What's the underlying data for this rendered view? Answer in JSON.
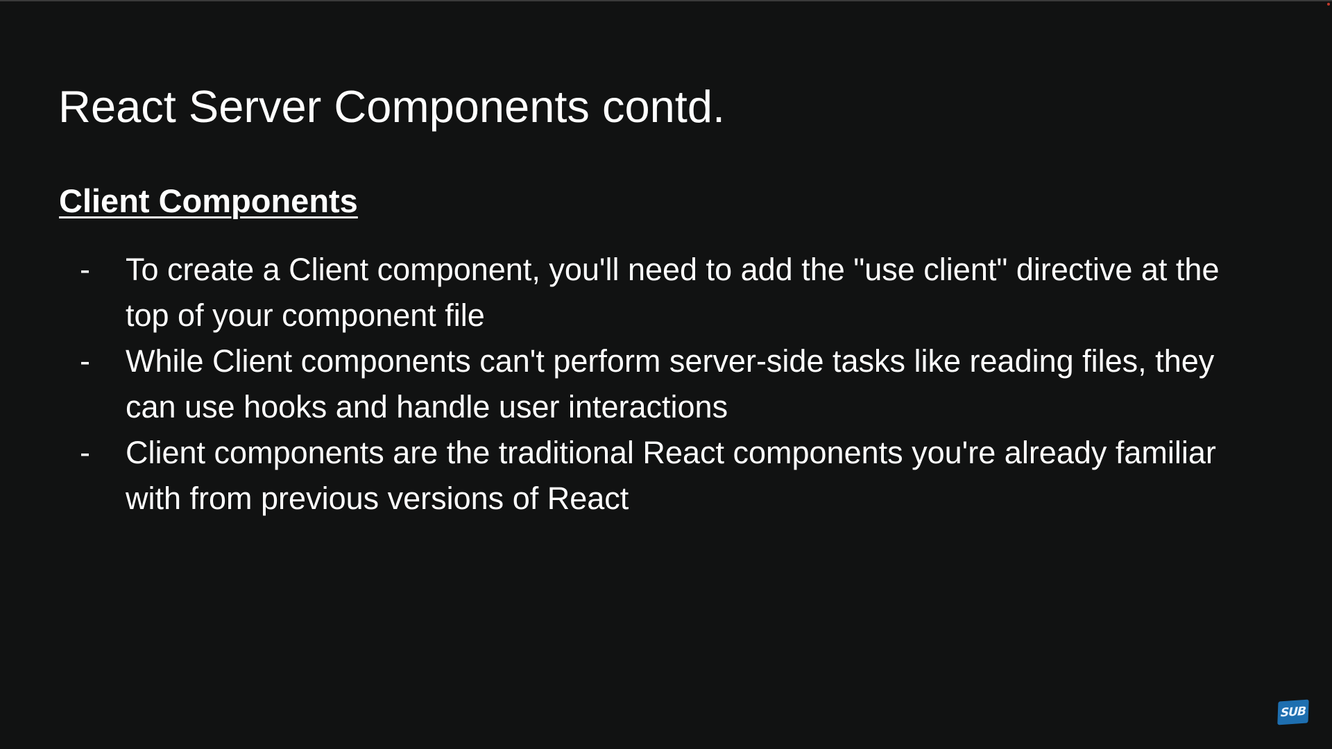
{
  "slide": {
    "title": "React Server Components contd.",
    "section_heading": "Client Components",
    "bullets": [
      {
        "marker": "-",
        "text": "To create a Client component, you'll need to add the \"use client\" directive at the top of your component file"
      },
      {
        "marker": "-",
        "text": "While Client components can't perform server-side tasks like reading files, they can use hooks and handle user interactions"
      },
      {
        "marker": "-",
        "text": "Client components are the traditional React components you're already familiar with from previous versions of React"
      }
    ]
  },
  "watermark": {
    "logo_text": "SUB",
    "icon": "subscribe-logo-icon",
    "color": "#1e6fb0"
  },
  "colors": {
    "background": "#111212",
    "text": "#ffffff"
  }
}
